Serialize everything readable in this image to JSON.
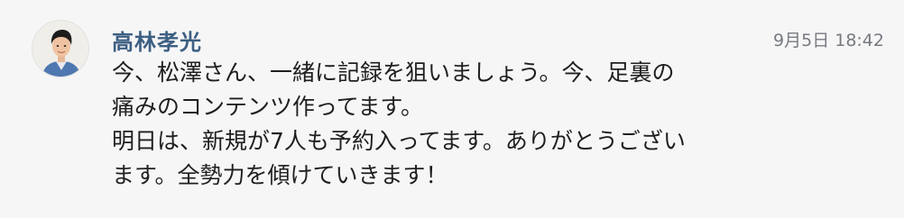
{
  "message": {
    "sender_name": "高林孝光",
    "timestamp": "9月5日 18:42",
    "avatar_icon": "person-avatar",
    "lines": [
      "今、松澤さん、一緒に記録を狙いましょう。今、足裏の",
      "痛みのコンテンツ作ってます。",
      "明日は、新規が7人も予約入ってます。ありがとうござい",
      "ます。全勢力を傾けていきます！"
    ]
  }
}
